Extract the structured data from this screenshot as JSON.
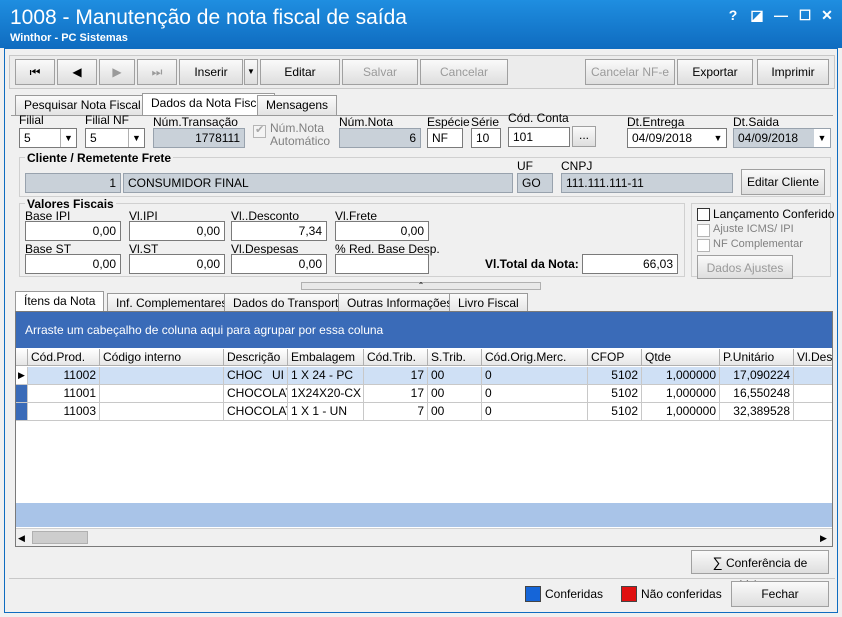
{
  "window": {
    "title": "1008 - Manutenção de nota fiscal de saída",
    "subtitle": "Winthor - PC Sistemas",
    "help": "?",
    "restore": "◪",
    "minimize": "—",
    "maximize": "☐",
    "close": "✕"
  },
  "toolbar": {
    "first": "⏮",
    "prev": "◀",
    "next": "▶",
    "last": "⏭",
    "insert": "Inserir",
    "insert_dd": "▼",
    "edit": "Editar",
    "save": "Salvar",
    "cancel": "Cancelar",
    "cancel_nfe": "Cancelar NF-e",
    "export": "Exportar",
    "print": "Imprimir"
  },
  "tabs": [
    "Pesquisar Nota Fiscal",
    "Dados da Nota Fiscal",
    "Mensagens"
  ],
  "form": {
    "filial_label": "Filial",
    "filial_value": "5",
    "filialnf_label": "Filial NF",
    "filialnf_value": "5",
    "num_transacao_label": "Núm.Transação",
    "num_transacao_value": "1778111",
    "num_nota_auto_label": "Núm.Nota Automático",
    "num_nota_label": "Núm.Nota",
    "num_nota_value": "6",
    "especie_label": "Espécie",
    "especie_value": "NF",
    "serie_label": "Série",
    "serie_value": "10",
    "cod_conta_label": "Cód. Conta",
    "cod_conta_value": "101",
    "cod_conta_btn": "...",
    "dt_entrega_label": "Dt.Entrega",
    "dt_entrega_value": "04/09/2018",
    "dt_saida_label": "Dt.Saida",
    "dt_saida_value": "04/09/2018",
    "cliente_group": "Cliente / Remetente Frete",
    "cliente_code": "1",
    "cliente_name": "CONSUMIDOR FINAL",
    "uf_label": "UF",
    "uf_value": "GO",
    "cnpj_label": "CNPJ",
    "cnpj_value": "111.111.111-11",
    "edit_client_btn": "Editar Cliente",
    "valores_group": "Valores Fiscais",
    "base_ipi_label": "Base IPI",
    "base_ipi_value": "0,00",
    "vl_ipi_label": "Vl.IPI",
    "vl_ipi_value": "0,00",
    "vl_desconto_label": "Vl..Desconto",
    "vl_desconto_value": "7,34",
    "vl_frete_label": "Vl.Frete",
    "vl_frete_value": "0,00",
    "base_st_label": "Base ST",
    "base_st_value": "0,00",
    "vl_st_label": "Vl.ST",
    "vl_st_value": "0,00",
    "vl_despesas_label": "Vl.Despesas",
    "vl_despesas_value": "0,00",
    "red_base_label": "% Red. Base Desp.",
    "red_base_value": "",
    "vl_total_label": "Vl.Total da Nota:",
    "vl_total_value": "66,03",
    "lanc_conferido": "Lançamento Conferido",
    "ajuste_icms": "Ajuste ICMS/ IPI",
    "nf_complementar": "NF Complementar",
    "dados_ajustes_btn": "Dados Ajustes"
  },
  "subtabs": [
    "Ítens da Nota",
    "Inf. Complementares",
    "Dados do Transporte",
    "Outras Informações",
    "Livro Fiscal"
  ],
  "grid": {
    "group_hint": "Arraste um cabeçalho de coluna aqui para agrupar por essa coluna",
    "columns": [
      "Cód.Prod.",
      "Código interno",
      "Descrição",
      "Embalagem",
      "Cód.Trib.",
      "S.Trib.",
      "Cód.Orig.Merc.",
      "CFOP",
      "Qtde",
      "P.Unitário",
      "Vl.Desco"
    ],
    "rows": [
      [
        "11002",
        "",
        "CHOC",
        "1 X 24 - PC",
        "17",
        "00",
        "0",
        "5102",
        "1,000000",
        "17,090224"
      ],
      [
        "11001",
        "",
        "CHOCOLATE",
        "1X24X20-CX",
        "17",
        "00",
        "0",
        "5102",
        "1,000000",
        "16,550248"
      ],
      [
        "11003",
        "",
        "CHOCOLATE",
        "1 X 1 - UN",
        "7",
        "00",
        "0",
        "5102",
        "1,000000",
        "32,389528"
      ]
    ],
    "row0_extra": "UI"
  },
  "footer": {
    "conferencia_btn": "Conferência de Valores",
    "conferidas": "Conferidas",
    "nao_conferidas": "Não conferidas",
    "fechar_btn": "Fechar",
    "color_conferidas": "#1565d8",
    "color_nao_conferidas": "#e01010"
  }
}
